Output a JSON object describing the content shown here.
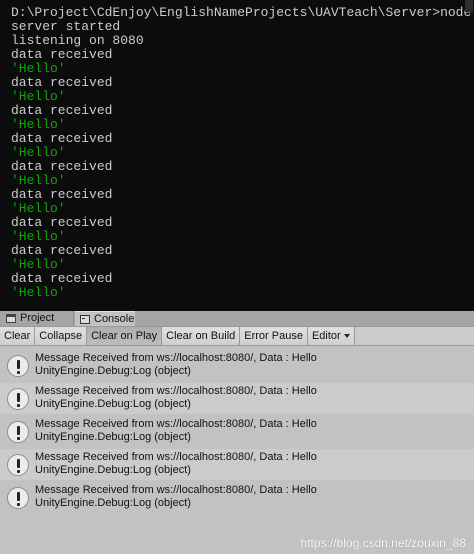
{
  "terminal": {
    "lines": [
      {
        "text": "D:\\Project\\CdEnjoy\\EnglishNameProjects\\UAVTeach\\Server>node index.",
        "style": "plain"
      },
      {
        "text": "server started",
        "style": "plain"
      },
      {
        "text": "listening on 8080",
        "style": "plain"
      },
      {
        "text": "data received",
        "style": "plain"
      },
      {
        "text": "'Hello'",
        "style": "str"
      },
      {
        "text": "data received",
        "style": "plain"
      },
      {
        "text": "'Hello'",
        "style": "str"
      },
      {
        "text": "data received",
        "style": "plain"
      },
      {
        "text": "'Hello'",
        "style": "str"
      },
      {
        "text": "data received",
        "style": "plain"
      },
      {
        "text": "'Hello'",
        "style": "str"
      },
      {
        "text": "data received",
        "style": "plain"
      },
      {
        "text": "'Hello'",
        "style": "str"
      },
      {
        "text": "data received",
        "style": "plain"
      },
      {
        "text": "'Hello'",
        "style": "str"
      },
      {
        "text": "data received",
        "style": "plain"
      },
      {
        "text": "'Hello'",
        "style": "str"
      },
      {
        "text": "data received",
        "style": "plain"
      },
      {
        "text": "'Hello'",
        "style": "str"
      },
      {
        "text": "data received",
        "style": "plain"
      },
      {
        "text": "'Hello'",
        "style": "str"
      }
    ]
  },
  "tabs": {
    "project": "Project",
    "console": "Console"
  },
  "toolbar": {
    "clear": "Clear",
    "collapse": "Collapse",
    "clear_on_play": "Clear on Play",
    "clear_on_build": "Clear on Build",
    "error_pause": "Error Pause",
    "editor": "Editor"
  },
  "logs": [
    {
      "message": "Message Received from ws://localhost:8080/, Data : Hello",
      "source": "UnityEngine.Debug:Log (object)"
    },
    {
      "message": "Message Received from ws://localhost:8080/, Data : Hello",
      "source": "UnityEngine.Debug:Log (object)"
    },
    {
      "message": "Message Received from ws://localhost:8080/, Data : Hello",
      "source": "UnityEngine.Debug:Log (object)"
    },
    {
      "message": "Message Received from ws://localhost:8080/, Data : Hello",
      "source": "UnityEngine.Debug:Log (object)"
    },
    {
      "message": "Message Received from ws://localhost:8080/, Data : Hello",
      "source": "UnityEngine.Debug:Log (object)"
    }
  ],
  "watermark": "https://blog.csdn.net/zouxin_88",
  "colors": {
    "terminal_bg": "#0c0c0c",
    "terminal_text": "#cccccc",
    "terminal_string": "#13a10e",
    "console_bg": "#c2c2c2"
  }
}
